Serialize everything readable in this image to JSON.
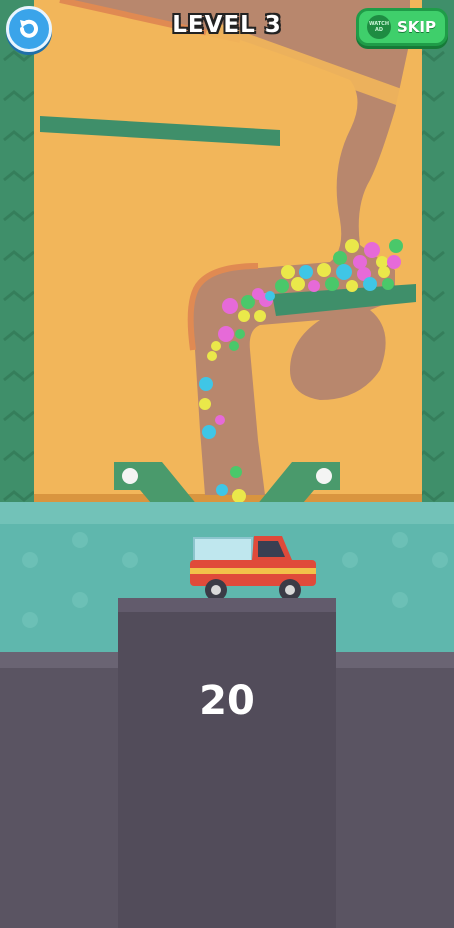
{
  "hud": {
    "level_label": "LEVEL 3",
    "skip_label": "SKIP",
    "watch_ad_label": "WATCH AD"
  },
  "game": {
    "balls_remaining": "20"
  },
  "colors": {
    "wood": "#f2b65a",
    "dirt": "#b8876d",
    "frame_green": "#3f8f6a",
    "water": "#5fb7ad",
    "truck_red": "#e04a3a",
    "skip_green": "#3fcf6b",
    "restart_blue": "#3aa4ea"
  }
}
